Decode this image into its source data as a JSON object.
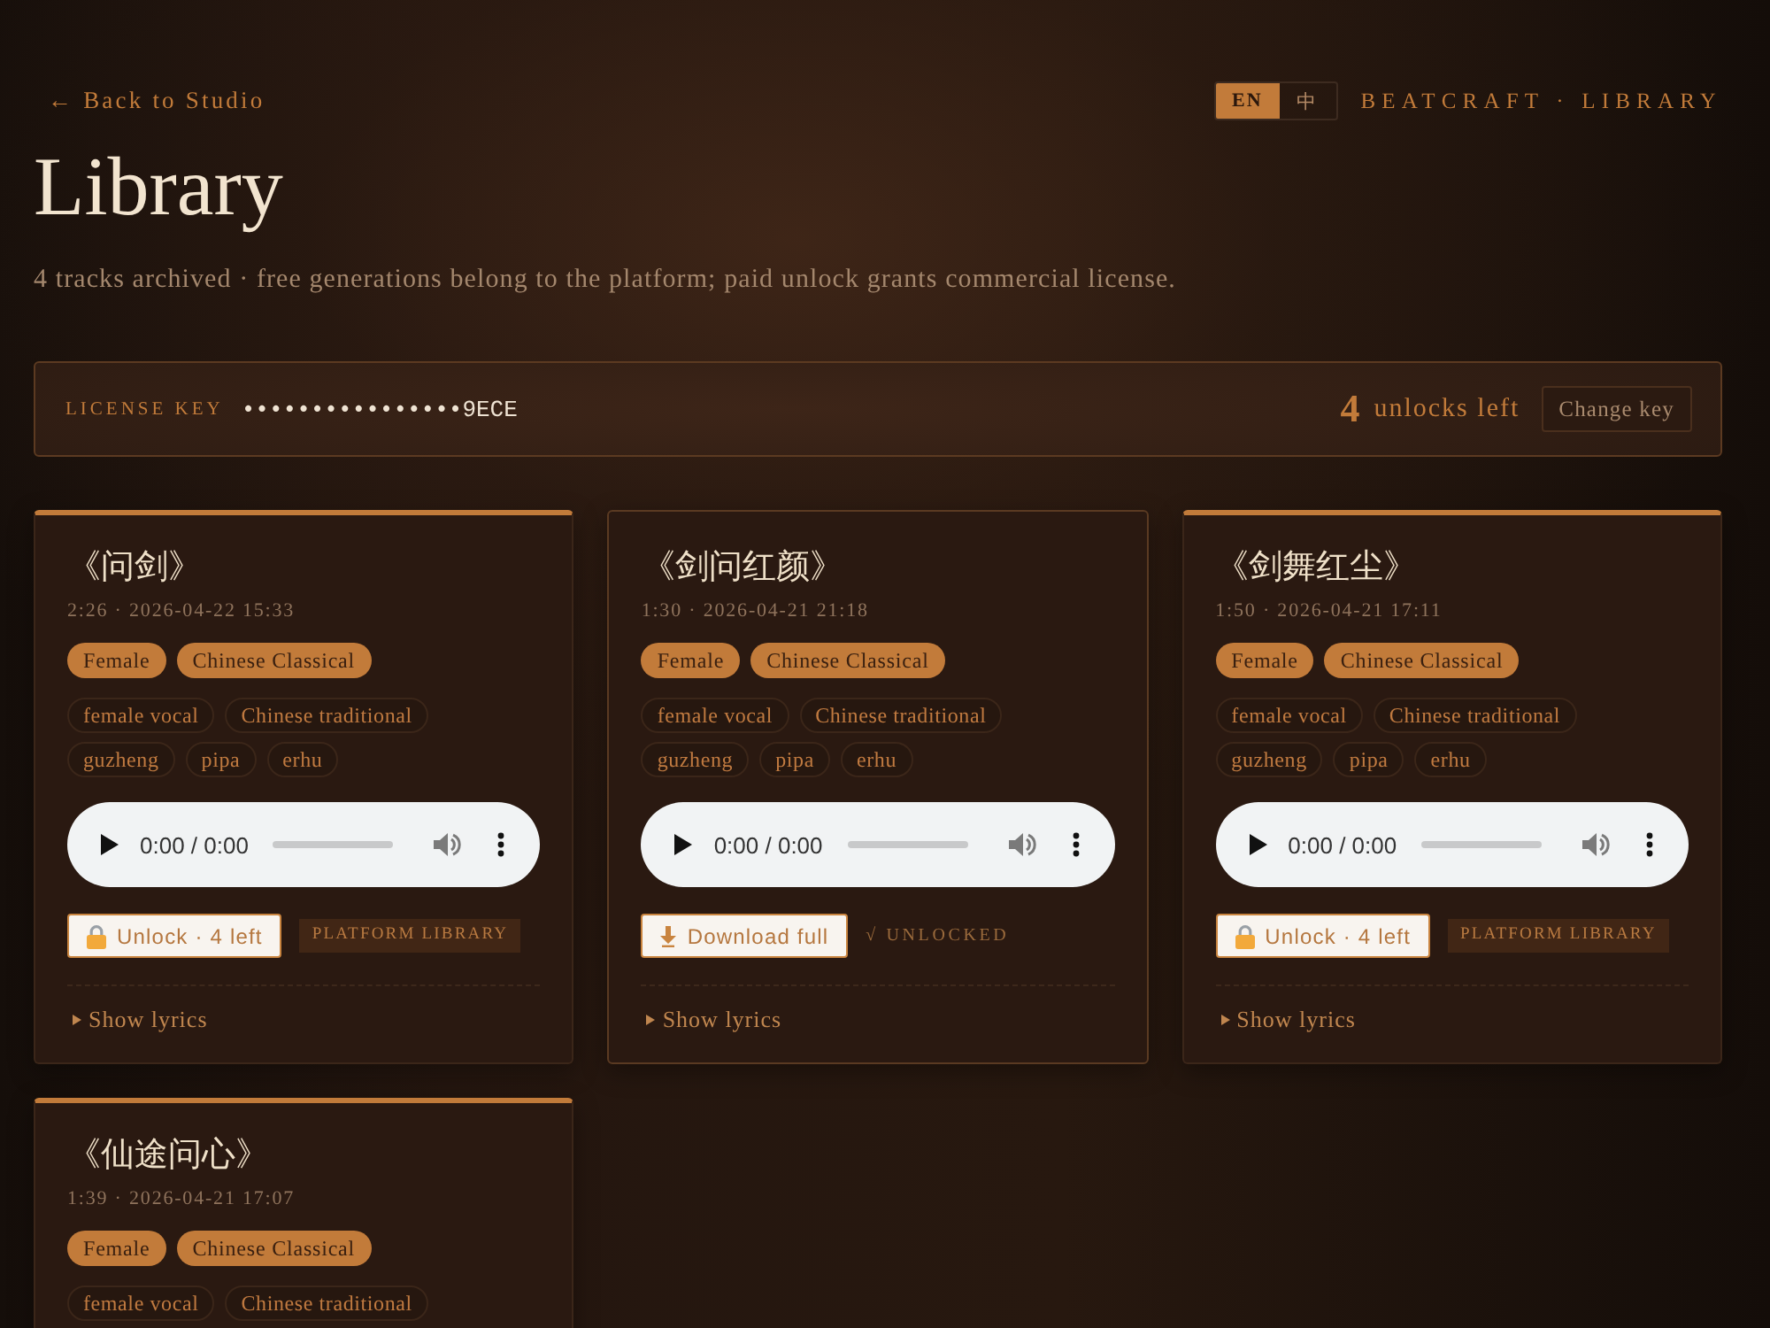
{
  "nav": {
    "back_link": "← Back to Studio",
    "languages": [
      {
        "label": "EN",
        "selected": true
      },
      {
        "label": "中",
        "selected": false
      }
    ],
    "brand": "BEATCRAFT · LIBRARY"
  },
  "header": {
    "title": "Library",
    "subtitle": "4 tracks archived · free generations belong to the platform; paid unlock grants commercial license."
  },
  "license": {
    "label": "LICENSE KEY",
    "key": "••••••••••••••••9ECE",
    "unlocks_count": "4",
    "unlocks_label": "unlocks left",
    "change_button": "Change key"
  },
  "tracks": [
    {
      "title": "《问剑》",
      "meta": "2:26 · 2026-04-22 15:33",
      "unlocked": false,
      "genre_tags": [
        "Female",
        "Chinese Classical"
      ],
      "tags": [
        "female vocal",
        "Chinese traditional",
        "guzheng",
        "pipa",
        "erhu"
      ],
      "player": {
        "time": "0:00 / 0:00"
      },
      "action": {
        "kind": "unlock",
        "label": "Unlock · 4 left"
      },
      "status": {
        "kind": "badge",
        "label": "PLATFORM LIBRARY"
      },
      "lyrics": {
        "label": "Show lyrics",
        "expanded": false
      }
    },
    {
      "title": "《剑问红颜》",
      "meta": "1:30 · 2026-04-21 21:18",
      "unlocked": true,
      "genre_tags": [
        "Female",
        "Chinese Classical"
      ],
      "tags": [
        "female vocal",
        "Chinese traditional",
        "guzheng",
        "pipa",
        "erhu"
      ],
      "player": {
        "time": "0:00 / 0:00"
      },
      "action": {
        "kind": "download",
        "label": "Download full"
      },
      "status": {
        "kind": "note",
        "label": "√ UNLOCKED"
      },
      "lyrics": {
        "label": "Show lyrics",
        "expanded": false
      }
    },
    {
      "title": "《剑舞红尘》",
      "meta": "1:50 · 2026-04-21 17:11",
      "unlocked": false,
      "genre_tags": [
        "Female",
        "Chinese Classical"
      ],
      "tags": [
        "female vocal",
        "Chinese traditional",
        "guzheng",
        "pipa",
        "erhu"
      ],
      "player": {
        "time": "0:00 / 0:00"
      },
      "action": {
        "kind": "unlock",
        "label": "Unlock · 4 left"
      },
      "status": {
        "kind": "badge",
        "label": "PLATFORM LIBRARY"
      },
      "lyrics": {
        "label": "Show lyrics",
        "expanded": false
      }
    },
    {
      "title": "《仙途问心》",
      "meta": "1:39 · 2026-04-21 17:07",
      "unlocked": false,
      "genre_tags": [
        "Female",
        "Chinese Classical"
      ],
      "tags": [
        "female vocal",
        "Chinese traditional"
      ]
    }
  ]
}
